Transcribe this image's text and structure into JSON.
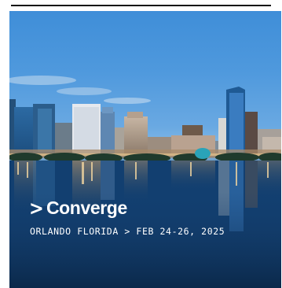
{
  "banner": {
    "brand": "Converge",
    "chevron": ">",
    "tagline": "ORLANDO FLORIDA > FEB 24-26, 2025",
    "image": "orlando-skyline-photo"
  },
  "colors": {
    "sky": "#4f99dd",
    "water": "#0e3a6a",
    "text": "#ffffff"
  }
}
